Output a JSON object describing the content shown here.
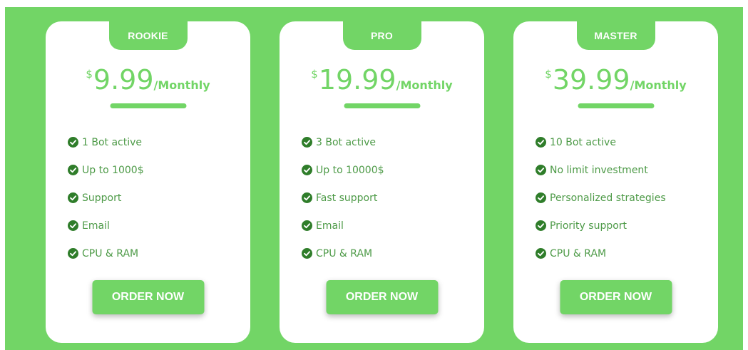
{
  "colors": {
    "accent": "#72d566",
    "feature_text": "#4d9a47",
    "check_icon": "#2f7d2a",
    "card": "#ffffff"
  },
  "plans": [
    {
      "badge": "ROOKIE",
      "currency": "$",
      "amount": "9.99",
      "period": "/Monthly",
      "features": [
        "1 Bot active",
        "Up to 1000$",
        "Support",
        "Email",
        "CPU & RAM"
      ],
      "button": "ORDER NOW"
    },
    {
      "badge": "PRO",
      "currency": "$",
      "amount": "19.99",
      "period": "/Monthly",
      "features": [
        "3 Bot active",
        "Up to 10000$",
        "Fast support",
        "Email",
        "CPU & RAM"
      ],
      "button": "ORDER NOW"
    },
    {
      "badge": "MASTER",
      "currency": "$",
      "amount": "39.99",
      "period": "/Monthly",
      "features": [
        "10 Bot active",
        "No limit investment",
        "Personalized strategies",
        "Priority support",
        "CPU & RAM"
      ],
      "button": "ORDER NOW"
    }
  ]
}
